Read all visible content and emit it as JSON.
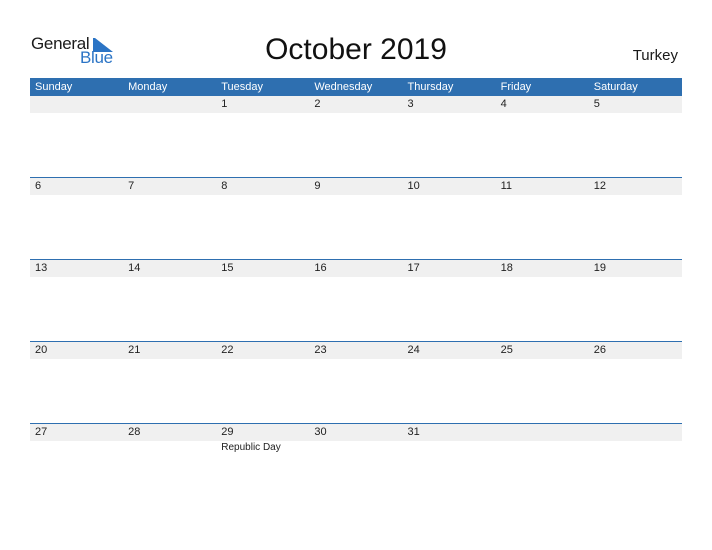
{
  "logo": {
    "general": "General",
    "blue": "Blue",
    "icon": "triangle-flag-icon"
  },
  "title": "October 2019",
  "country": "Turkey",
  "colors": {
    "header_bg": "#2e6fb0",
    "band_bg": "#f0f0f0",
    "brand_blue": "#2b74c5"
  },
  "weekdays": [
    "Sunday",
    "Monday",
    "Tuesday",
    "Wednesday",
    "Thursday",
    "Friday",
    "Saturday"
  ],
  "weeks": [
    [
      {
        "d": ""
      },
      {
        "d": ""
      },
      {
        "d": "1"
      },
      {
        "d": "2"
      },
      {
        "d": "3"
      },
      {
        "d": "4"
      },
      {
        "d": "5"
      }
    ],
    [
      {
        "d": "6"
      },
      {
        "d": "7"
      },
      {
        "d": "8"
      },
      {
        "d": "9"
      },
      {
        "d": "10"
      },
      {
        "d": "11"
      },
      {
        "d": "12"
      }
    ],
    [
      {
        "d": "13"
      },
      {
        "d": "14"
      },
      {
        "d": "15"
      },
      {
        "d": "16"
      },
      {
        "d": "17"
      },
      {
        "d": "18"
      },
      {
        "d": "19"
      }
    ],
    [
      {
        "d": "20"
      },
      {
        "d": "21"
      },
      {
        "d": "22"
      },
      {
        "d": "23"
      },
      {
        "d": "24"
      },
      {
        "d": "25"
      },
      {
        "d": "26"
      }
    ],
    [
      {
        "d": "27"
      },
      {
        "d": "28"
      },
      {
        "d": "29",
        "event": "Republic Day"
      },
      {
        "d": "30"
      },
      {
        "d": "31"
      },
      {
        "d": ""
      },
      {
        "d": ""
      }
    ]
  ]
}
